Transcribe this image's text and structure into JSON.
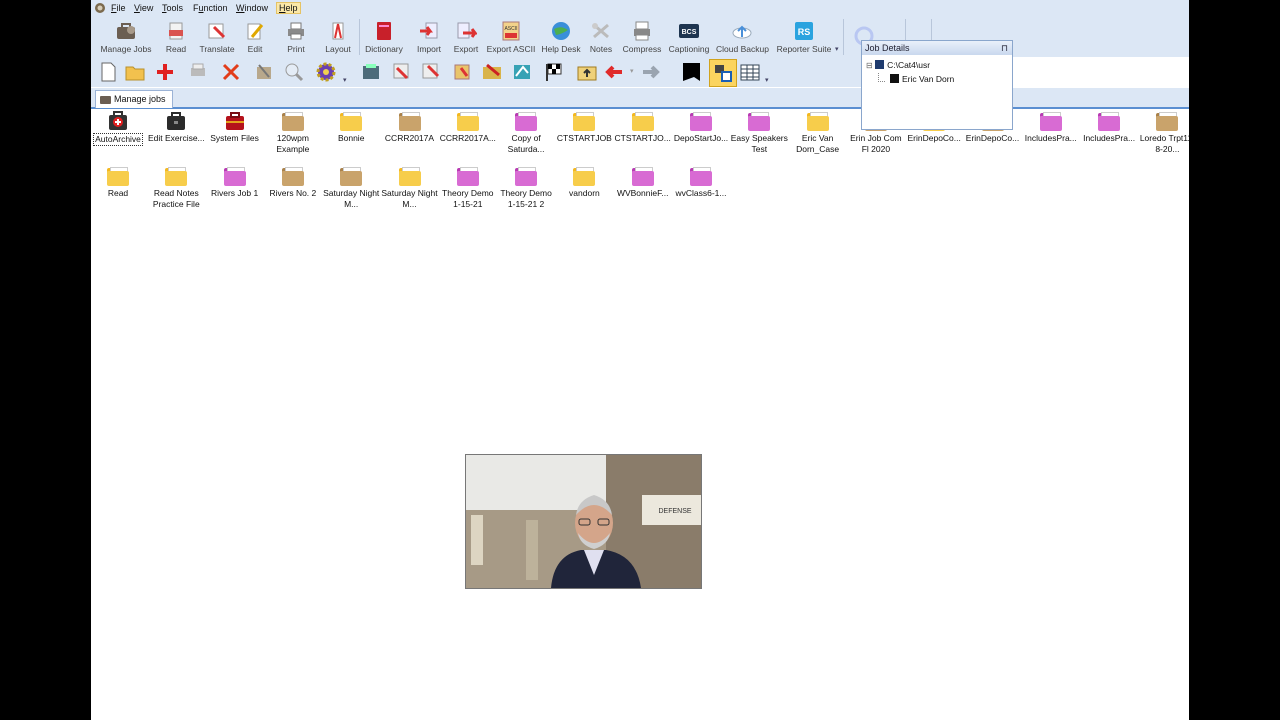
{
  "menu": {
    "items": [
      {
        "label": "File",
        "key": "F"
      },
      {
        "label": "View",
        "key": "V"
      },
      {
        "label": "Tools",
        "key": "T"
      },
      {
        "label": "Function",
        "key": "u"
      },
      {
        "label": "Window",
        "key": "W"
      },
      {
        "label": "Help",
        "key": "H"
      }
    ]
  },
  "ribbon": {
    "buttons": [
      {
        "label": "Manage Jobs",
        "icon": "manage-jobs-icon"
      },
      {
        "label": "Read",
        "icon": "read-icon"
      },
      {
        "label": "Translate",
        "icon": "translate-icon"
      },
      {
        "label": "Edit",
        "icon": "edit-icon"
      },
      {
        "label": "Print",
        "icon": "print-icon"
      },
      {
        "label": "Layout",
        "icon": "layout-icon"
      },
      {
        "label": "Dictionary",
        "icon": "dictionary-icon"
      },
      {
        "label": "Import",
        "icon": "import-icon"
      },
      {
        "label": "Export",
        "icon": "export-icon"
      },
      {
        "label": "Export ASCII",
        "icon": "export-ascii-icon"
      },
      {
        "label": "Help Desk",
        "icon": "help-desk-icon"
      },
      {
        "label": "Notes",
        "icon": "notes-icon"
      },
      {
        "label": "Compress",
        "icon": "compress-icon"
      },
      {
        "label": "Captioning",
        "icon": "captioning-icon"
      },
      {
        "label": "Cloud Backup",
        "icon": "cloud-backup-icon"
      },
      {
        "label": "Reporter Suite",
        "icon": "reporter-suite-icon"
      }
    ],
    "bcs_text": "BCS",
    "ascii_text": "ASCII",
    "rs_text": "RS"
  },
  "tabs": {
    "manage_jobs": "Manage jobs"
  },
  "job_details": {
    "title": "Job Details",
    "path": "C:\\Cat4\\usr",
    "child": "Eric Van Dorn"
  },
  "grid": {
    "row1": [
      {
        "label": "AutoArchive",
        "type": "archive"
      },
      {
        "label": "Edit Exercise...",
        "type": "briefcase"
      },
      {
        "label": "System Files",
        "type": "redcase"
      },
      {
        "label": "120wpm Example",
        "type": "brown"
      },
      {
        "label": "Bonnie",
        "type": "yellow"
      },
      {
        "label": "CCRR2017A",
        "type": "brown"
      },
      {
        "label": "CCRR2017A...",
        "type": "yellow"
      },
      {
        "label": "Copy of Saturda...",
        "type": "pink"
      },
      {
        "label": "CTSTARTJOB",
        "type": "yellow"
      },
      {
        "label": "CTSTARTJO...",
        "type": "yellow"
      },
      {
        "label": "DepoStartJo...",
        "type": "pink"
      },
      {
        "label": "Easy Speakers Test",
        "type": "pink"
      },
      {
        "label": "Eric Van Dorn_Case",
        "type": "yellow"
      },
      {
        "label": "Erin Job Com Fl 2020",
        "type": "brown"
      },
      {
        "label": "ErinDepoCo...",
        "type": "yellow"
      },
      {
        "label": "ErinDepoCo...",
        "type": "brown"
      },
      {
        "label": "IncludesPra...",
        "type": "pink"
      },
      {
        "label": "IncludesPra...",
        "type": "pink"
      },
      {
        "label": "Loredo Trpt11-8-20...",
        "type": "brown"
      }
    ],
    "row2": [
      {
        "label": "Read",
        "type": "yellow"
      },
      {
        "label": "Read Notes Practice File",
        "type": "yellow"
      },
      {
        "label": "Rivers Job 1",
        "type": "pink"
      },
      {
        "label": "Rivers No. 2",
        "type": "brown"
      },
      {
        "label": "Saturday Night M...",
        "type": "brown"
      },
      {
        "label": "Saturday Night M...",
        "type": "yellow"
      },
      {
        "label": "Theory Demo 1-15-21",
        "type": "pink"
      },
      {
        "label": "Theory Demo 1-15-21 2",
        "type": "pink"
      },
      {
        "label": "vandorn",
        "type": "yellow"
      },
      {
        "label": "WVBonnieF...",
        "type": "pink"
      },
      {
        "label": "wvClass6-1...",
        "type": "pink"
      }
    ]
  },
  "video": {
    "sign_text": "DEFENSE"
  },
  "colors": {
    "chrome": "#dce7f5",
    "folder_yellow": "#f5c43b",
    "folder_brown": "#b79058",
    "folder_pink": "#c84bc4",
    "accent": "#5b8fd1"
  }
}
